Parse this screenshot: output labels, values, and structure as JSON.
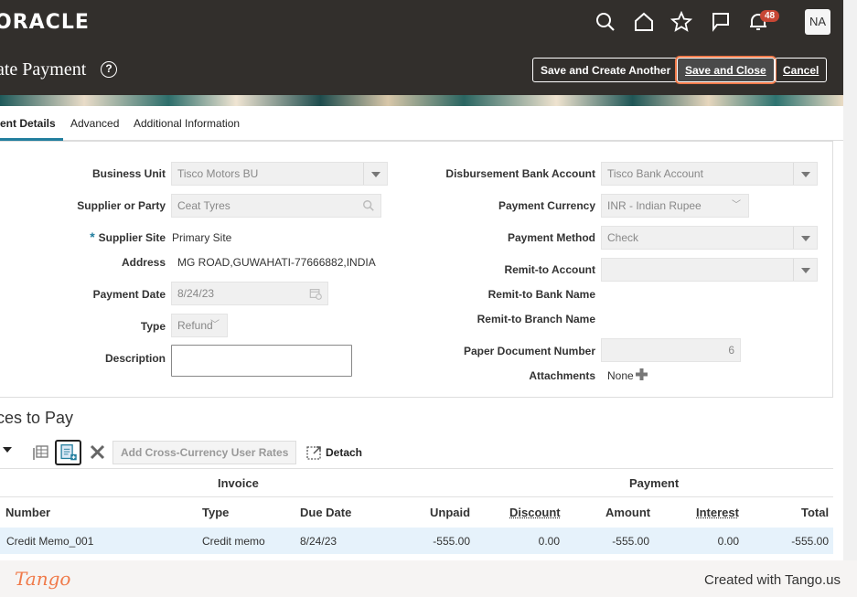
{
  "brand": {
    "logo_text": "ORACLE"
  },
  "topbar": {
    "icons": [
      "search-icon",
      "home-icon",
      "star-icon",
      "flag-icon",
      "bell-icon"
    ],
    "notification_count": "48",
    "avatar_initials": "NA"
  },
  "header": {
    "title": "ate Payment",
    "buttons": {
      "save_create_another": "Save and Create Another",
      "save_close": "Save and Close",
      "cancel": "Cancel"
    }
  },
  "tabs": [
    {
      "label": "ent Details",
      "active": true
    },
    {
      "label": "Advanced",
      "active": false
    },
    {
      "label": "Additional Information",
      "active": false
    }
  ],
  "form": {
    "business_unit": {
      "label": "Business Unit",
      "value": "Tisco Motors BU"
    },
    "supplier": {
      "label": "Supplier or Party",
      "value": "Ceat Tyres"
    },
    "supplier_site": {
      "label": "Supplier Site",
      "value": "Primary Site",
      "required_mark": "*"
    },
    "address": {
      "label": "Address",
      "value": "MG ROAD,GUWAHATI-77666882,INDIA"
    },
    "payment_date": {
      "label": "Payment Date",
      "value": "8/24/23"
    },
    "type": {
      "label": "Type",
      "value": "Refund"
    },
    "description": {
      "label": "Description",
      "value": ""
    },
    "disbursement_bank_account": {
      "label": "Disbursement Bank Account",
      "value": "Tisco Bank Account"
    },
    "payment_currency": {
      "label": "Payment Currency",
      "value": "INR - Indian Rupee"
    },
    "payment_method": {
      "label": "Payment Method",
      "value": "Check"
    },
    "remit_to_account": {
      "label": "Remit-to Account",
      "value": ""
    },
    "remit_to_bank_name": {
      "label": "Remit-to Bank Name"
    },
    "remit_to_branch_name": {
      "label": "Remit-to Branch Name"
    },
    "paper_document_number": {
      "label": "Paper Document Number",
      "value": "6"
    },
    "attachments": {
      "label": "Attachments",
      "value": "None"
    }
  },
  "invoices": {
    "section_title": "ces to Pay",
    "toolbar": {
      "add_rates": "Add Cross-Currency User Rates",
      "detach": "Detach"
    },
    "group_headers": {
      "invoice": "Invoice",
      "payment": "Payment"
    },
    "columns": [
      "Number",
      "Type",
      "Due Date",
      "Unpaid",
      "Discount",
      "Amount",
      "Interest",
      "Total"
    ],
    "rows": [
      {
        "number": "Credit Memo_001",
        "type": "Credit memo",
        "due_date": "8/24/23",
        "unpaid": "-555.00",
        "discount": "0.00",
        "amount": "-555.00",
        "interest": "0.00",
        "total": "-555.00"
      }
    ]
  },
  "footer": {
    "logo": "Tango",
    "credit": "Created with Tango.us"
  },
  "colors": {
    "header_bg": "#322f2c",
    "accent": "#227e9e",
    "highlight": "#f07a4a",
    "row_selected": "#e6f2fb"
  }
}
